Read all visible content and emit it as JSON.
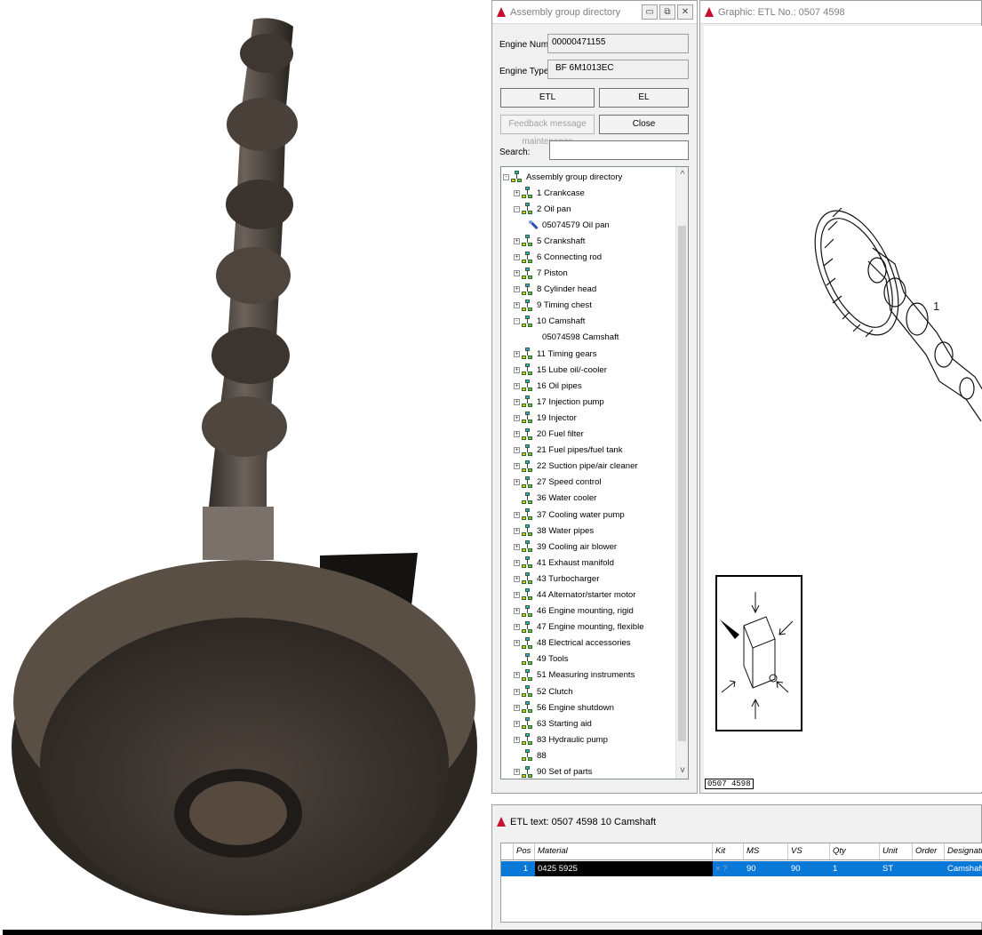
{
  "assembly_window": {
    "title": "Assembly group directory",
    "engine_number_label": "Engine Number:",
    "engine_number_value": "00000471155",
    "engine_type_label": "Engine Type:",
    "engine_type_value": "BF 6M1013EC",
    "etl_button": "ETL",
    "el_button": "EL",
    "feedback_button": "Feedback message maintenance",
    "close_button": "Close",
    "search_label": "Search:",
    "search_value": "",
    "tree": [
      {
        "label": "Assembly group directory",
        "kind": "root",
        "level": 0,
        "expander": "-"
      },
      {
        "label": "1  Crankcase",
        "kind": "group",
        "level": 1,
        "expander": "+"
      },
      {
        "label": "2  Oil pan",
        "kind": "group",
        "level": 1,
        "expander": "-"
      },
      {
        "label": "05074579  Oil pan",
        "kind": "part",
        "level": 2,
        "expander": ""
      },
      {
        "label": "5  Crankshaft",
        "kind": "group",
        "level": 1,
        "expander": "+"
      },
      {
        "label": "6  Connecting rod",
        "kind": "group",
        "level": 1,
        "expander": "+"
      },
      {
        "label": "7  Piston",
        "kind": "group",
        "level": 1,
        "expander": "+"
      },
      {
        "label": "8  Cylinder head",
        "kind": "group",
        "level": 1,
        "expander": "+"
      },
      {
        "label": "9  Timing chest",
        "kind": "group",
        "level": 1,
        "expander": "+"
      },
      {
        "label": "10  Camshaft",
        "kind": "group",
        "level": 1,
        "expander": "-"
      },
      {
        "label": "05074598  Camshaft",
        "kind": "text",
        "level": 2,
        "expander": ""
      },
      {
        "label": "11  Timing gears",
        "kind": "group",
        "level": 1,
        "expander": "+"
      },
      {
        "label": "15  Lube oil/-cooler",
        "kind": "group",
        "level": 1,
        "expander": "+"
      },
      {
        "label": "16  Oil pipes",
        "kind": "group",
        "level": 1,
        "expander": "+"
      },
      {
        "label": "17  Injection pump",
        "kind": "group",
        "level": 1,
        "expander": "+"
      },
      {
        "label": "19  Injector",
        "kind": "group",
        "level": 1,
        "expander": "+"
      },
      {
        "label": "20  Fuel filter",
        "kind": "group",
        "level": 1,
        "expander": "+"
      },
      {
        "label": "21  Fuel pipes/fuel tank",
        "kind": "group",
        "level": 1,
        "expander": "+"
      },
      {
        "label": "22  Suction pipe/air cleaner",
        "kind": "group",
        "level": 1,
        "expander": "+"
      },
      {
        "label": "27  Speed control",
        "kind": "group",
        "level": 1,
        "expander": "+"
      },
      {
        "label": "36  Water cooler",
        "kind": "group",
        "level": 1,
        "expander": ""
      },
      {
        "label": "37  Cooling water pump",
        "kind": "group",
        "level": 1,
        "expander": "+"
      },
      {
        "label": "38  Water pipes",
        "kind": "group",
        "level": 1,
        "expander": "+"
      },
      {
        "label": "39  Cooling air blower",
        "kind": "group",
        "level": 1,
        "expander": "+"
      },
      {
        "label": "41  Exhaust manifold",
        "kind": "group",
        "level": 1,
        "expander": "+"
      },
      {
        "label": "43  Turbocharger",
        "kind": "group",
        "level": 1,
        "expander": "+"
      },
      {
        "label": "44  Alternator/starter motor",
        "kind": "group",
        "level": 1,
        "expander": "+"
      },
      {
        "label": "46  Engine mounting, rigid",
        "kind": "group",
        "level": 1,
        "expander": "+"
      },
      {
        "label": "47  Engine mounting, flexible",
        "kind": "group",
        "level": 1,
        "expander": "+"
      },
      {
        "label": "48  Electrical accessories",
        "kind": "group",
        "level": 1,
        "expander": "+"
      },
      {
        "label": "49  Tools",
        "kind": "group",
        "level": 1,
        "expander": ""
      },
      {
        "label": "51  Measuring instruments",
        "kind": "group",
        "level": 1,
        "expander": "+"
      },
      {
        "label": "52  Clutch",
        "kind": "group",
        "level": 1,
        "expander": "+"
      },
      {
        "label": "56  Engine shutdown",
        "kind": "group",
        "level": 1,
        "expander": "+"
      },
      {
        "label": "63  Starting aid",
        "kind": "group",
        "level": 1,
        "expander": "+"
      },
      {
        "label": "83  Hydraulic pump",
        "kind": "group",
        "level": 1,
        "expander": "+"
      },
      {
        "label": "88",
        "kind": "group",
        "level": 1,
        "expander": ""
      },
      {
        "label": "90  Set of parts",
        "kind": "group",
        "level": 1,
        "expander": "+"
      }
    ]
  },
  "graphic_window": {
    "title": "Graphic: ETL No.: 0507 4598",
    "callout_number": "1",
    "drawing_number": "0507 4598"
  },
  "etl_window": {
    "title": "ETL text: 0507 4598   10  Camshaft",
    "columns": [
      "Pos",
      "Material",
      "Kit",
      "MS",
      "VS",
      "Qty",
      "Unit",
      "Order",
      "Designation (e"
    ],
    "rows": [
      {
        "pos": "1",
        "material": "0425 5925",
        "kit": "× ?",
        "ms": "90",
        "vs": "90",
        "qty": "1",
        "unit": "ST",
        "order": "",
        "designation": "Camshaft"
      }
    ]
  },
  "colors": {
    "selection_blue": "#0a78d7",
    "brand_red": "#c8102e",
    "window_bg": "#f0f0f0"
  }
}
